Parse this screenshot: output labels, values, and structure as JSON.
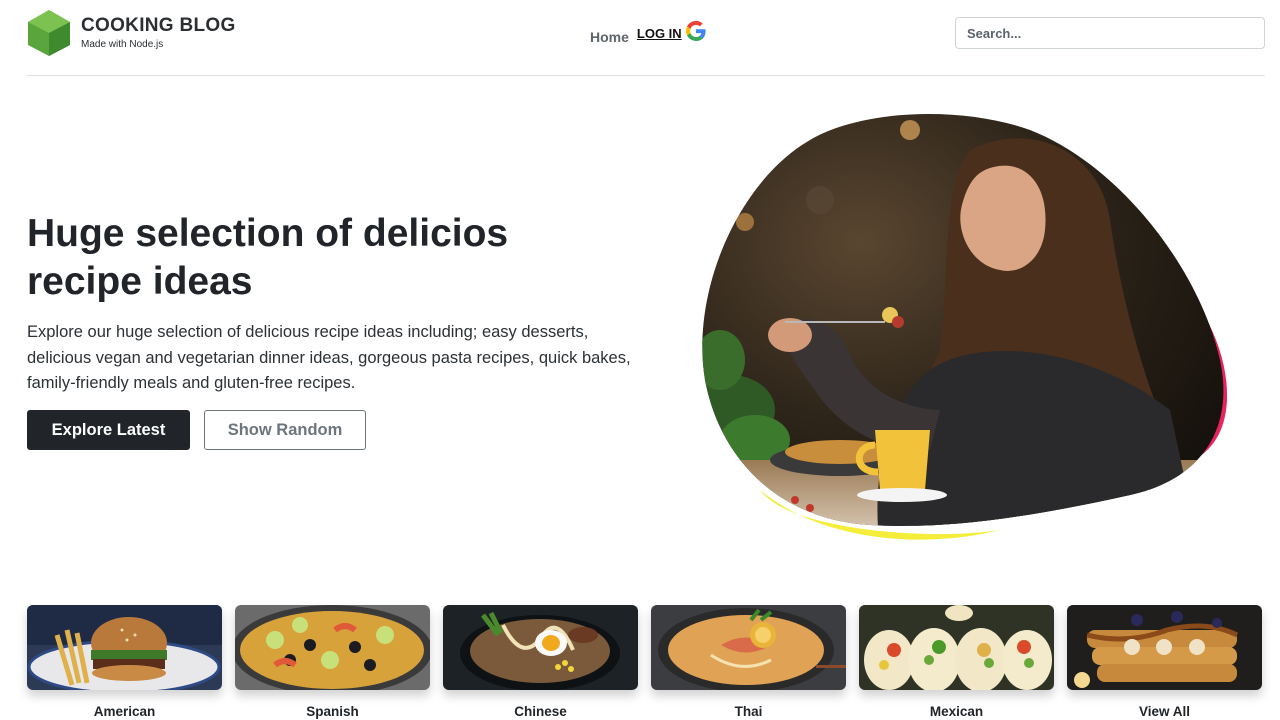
{
  "brand": {
    "title": "COOKING BLOG",
    "subtitle": "Made with Node.js",
    "logo_icon": "node-hexagon-logo"
  },
  "nav": {
    "home": "Home",
    "login": "LOG IN",
    "login_icon": "google-g-icon"
  },
  "search": {
    "placeholder": "Search..."
  },
  "hero": {
    "title": "Huge selection of delicios recipe ideas",
    "text": "Explore our huge selection of delicious recipe ideas including; easy desserts, delicious vegan and vegetarian dinner ideas, gorgeous pasta recipes, quick bakes, family-friendly meals and gluten-free recipes.",
    "primary_button": "Explore Latest",
    "secondary_button": "Show Random",
    "image": "woman-eating-pasta-blob-photo"
  },
  "categories": [
    {
      "label": "American",
      "image": "burger-photo"
    },
    {
      "label": "Spanish",
      "image": "paella-photo"
    },
    {
      "label": "Chinese",
      "image": "ramen-photo"
    },
    {
      "label": "Thai",
      "image": "curry-noodles-photo"
    },
    {
      "label": "Mexican",
      "image": "tacos-photo"
    },
    {
      "label": "View All",
      "image": "pancakes-photo"
    }
  ],
  "colors": {
    "primary_dark": "#212529",
    "outline_gray": "#6c757d",
    "blob_pink": "#e8245f",
    "blob_yellow": "#f4ee3a",
    "logo_green": "#5aa63c"
  }
}
